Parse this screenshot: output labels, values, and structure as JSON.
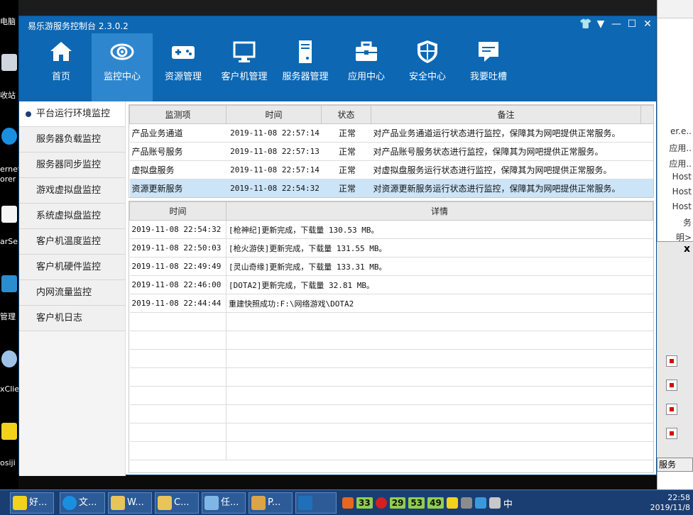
{
  "desktop": {
    "icons": [
      {
        "label": "电脑"
      },
      {
        "label": "收站"
      },
      {
        "label": "ernet"
      },
      {
        "label": "orer"
      },
      {
        "label": "arSe"
      },
      {
        "label": "管理"
      },
      {
        "label": "xClie"
      },
      {
        "label": "osiji"
      }
    ],
    "bg_window_lines": [
      "er.e..",
      "应用..",
      "应用..",
      "Host",
      "Host",
      "Host",
      "务",
      "明>"
    ],
    "bg_dialog": {
      "close": "x",
      "button_label": "服务"
    }
  },
  "app": {
    "title": "易乐游服务控制台 2.3.0.2",
    "controls": {
      "shirt": "👕",
      "menu": "▼",
      "minimize": "—",
      "maximize": "☐",
      "close": "✕"
    },
    "nav": [
      {
        "label": "首页",
        "icon": "home-icon"
      },
      {
        "label": "监控中心",
        "icon": "eye-icon",
        "active": true
      },
      {
        "label": "资源管理",
        "icon": "gamepad-icon"
      },
      {
        "label": "客户机管理",
        "icon": "monitor-icon"
      },
      {
        "label": "服务器管理",
        "icon": "server-icon"
      },
      {
        "label": "应用中心",
        "icon": "toolbox-icon"
      },
      {
        "label": "安全中心",
        "icon": "shield-icon"
      },
      {
        "label": "我要吐槽",
        "icon": "chat-icon"
      }
    ],
    "side_menu": [
      {
        "label": "平台运行环境监控",
        "active": true
      },
      {
        "label": "服务器负载监控"
      },
      {
        "label": "服务器同步监控"
      },
      {
        "label": "游戏虚拟盘监控"
      },
      {
        "label": "系统虚拟盘监控"
      },
      {
        "label": "客户机温度监控"
      },
      {
        "label": "客户机硬件监控"
      },
      {
        "label": "内网流量监控"
      },
      {
        "label": "客户机日志"
      }
    ],
    "monitor_table": {
      "headers": [
        "监测项",
        "时间",
        "状态",
        "备注"
      ],
      "rows": [
        {
          "item": "产品业务通道",
          "time": "2019-11-08 22:57:14",
          "status": "正常",
          "note": "对产品业务通道运行状态进行监控，保障其为网吧提供正常服务。"
        },
        {
          "item": "产品账号服务",
          "time": "2019-11-08 22:57:13",
          "status": "正常",
          "note": "对产品账号服务状态进行监控，保障其为网吧提供正常服务。"
        },
        {
          "item": "虚拟盘服务",
          "time": "2019-11-08 22:57:14",
          "status": "正常",
          "note": "对虚拟盘服务运行状态进行监控，保障其为网吧提供正常服务。"
        },
        {
          "item": "资源更新服务",
          "time": "2019-11-08 22:54:32",
          "status": "正常",
          "note": "对资源更新服务运行状态进行监控，保障其为网吧提供正常服务。",
          "selected": true
        }
      ]
    },
    "log_table": {
      "headers": [
        "时间",
        "详情"
      ],
      "rows": [
        {
          "time": "2019-11-08 22:54:32",
          "detail": "[枪神纪]更新完成，下载量 130.53 MB。"
        },
        {
          "time": "2019-11-08 22:50:03",
          "detail": "[枪火游侠]更新完成，下载量 131.55 MB。"
        },
        {
          "time": "2019-11-08 22:49:49",
          "detail": "[灵山奇缘]更新完成，下载量 133.31 MB。"
        },
        {
          "time": "2019-11-08 22:46:00",
          "detail": "[DOTA2]更新完成，下载量 32.81 MB。"
        },
        {
          "time": "2019-11-08 22:44:44",
          "detail": "重建快照成功:F:\\网络游戏\\DOTA2"
        }
      ]
    }
  },
  "taskbar": {
    "buttons": [
      {
        "label": "好...",
        "icon": "driver-icon"
      },
      {
        "label": "文...",
        "icon": "ie-icon"
      },
      {
        "label": "W...",
        "icon": "folder-icon"
      },
      {
        "label": "C...",
        "icon": "folder-icon"
      },
      {
        "label": "任...",
        "icon": "taskmgr-icon"
      },
      {
        "label": "P...",
        "icon": "paint-icon"
      },
      {
        "label": "",
        "icon": "app-icon"
      }
    ],
    "tray_numbers": [
      "33",
      "29",
      "53",
      "49"
    ],
    "ime": "中",
    "clock_time": "22:58",
    "clock_date": "2019/11/8"
  },
  "colors": {
    "titlebar": "#0d67b3",
    "nav_active": "#2e86cf",
    "selected_row": "#cce4f7"
  }
}
